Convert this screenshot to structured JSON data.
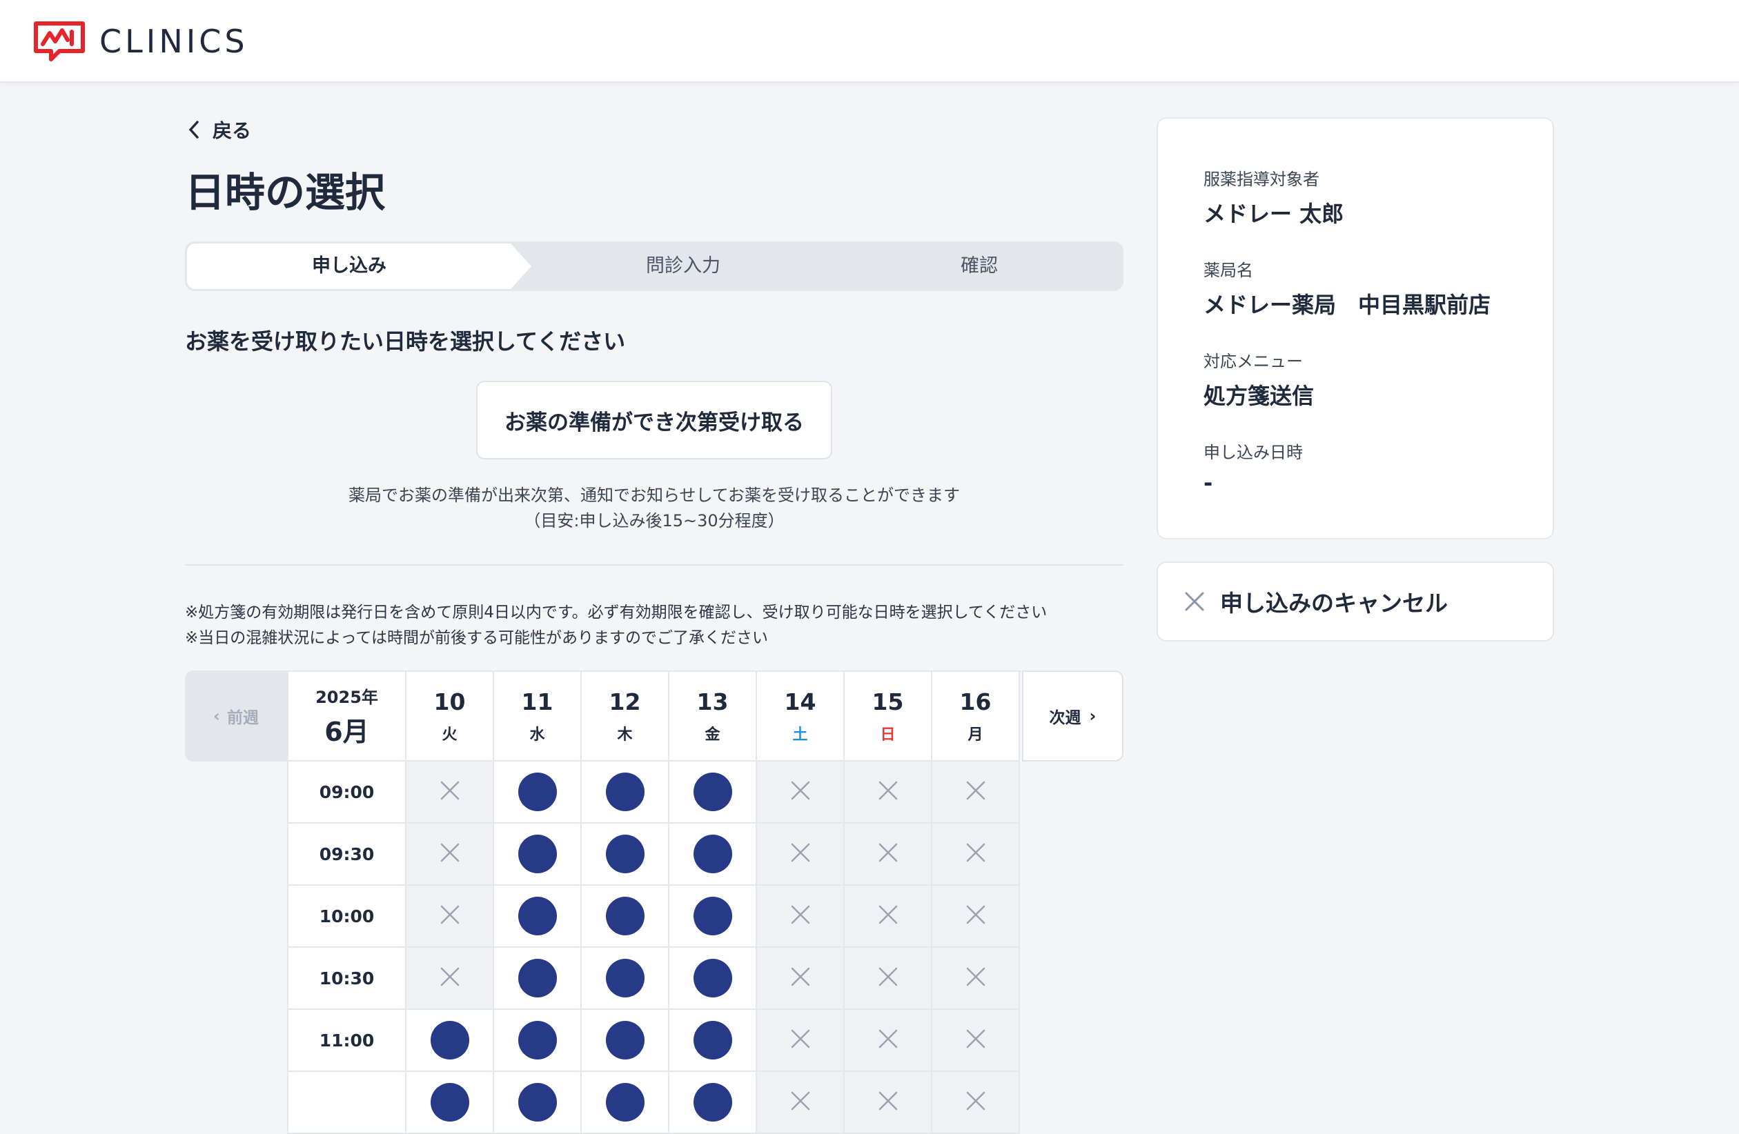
{
  "header": {
    "logo_text": "CLINICS",
    "brand_color": "#e5242b"
  },
  "back": {
    "label": "戻る"
  },
  "page_title": "日時の選択",
  "steps": [
    {
      "label": "申し込み",
      "active": true
    },
    {
      "label": "問診入力",
      "active": false
    },
    {
      "label": "確認",
      "active": false
    }
  ],
  "prompt": "お薬を受け取りたい日時を選択してください",
  "asap": {
    "button_label": "お薬の準備ができ次第受け取る",
    "desc_line1": "薬局でお薬の準備が出来次第、通知でお知らせしてお薬を受け取ることができます",
    "desc_line2": "（目安:申し込み後15~30分程度）"
  },
  "notes": {
    "line1": "※処方箋の有効期限は発行日を含めて原則4日以内です。必ず有効期限を確認し、受け取り可能な日時を選択してください",
    "line2": "※当日の混雑状況によっては時間が前後する可能性がありますのでご了承ください"
  },
  "calendar": {
    "prev_label": "前週",
    "next_label": "次週",
    "year": "2025年",
    "month": "6月",
    "days": [
      {
        "num": "10",
        "dow": "火",
        "type": "weekday"
      },
      {
        "num": "11",
        "dow": "水",
        "type": "weekday"
      },
      {
        "num": "12",
        "dow": "木",
        "type": "weekday"
      },
      {
        "num": "13",
        "dow": "金",
        "type": "weekday"
      },
      {
        "num": "14",
        "dow": "土",
        "type": "sat"
      },
      {
        "num": "15",
        "dow": "日",
        "type": "sun"
      },
      {
        "num": "16",
        "dow": "月",
        "type": "weekday"
      }
    ],
    "slots": [
      {
        "time": "09:00",
        "available": [
          false,
          true,
          true,
          true,
          false,
          false,
          false
        ]
      },
      {
        "time": "09:30",
        "available": [
          false,
          true,
          true,
          true,
          false,
          false,
          false
        ]
      },
      {
        "time": "10:00",
        "available": [
          false,
          true,
          true,
          true,
          false,
          false,
          false
        ]
      },
      {
        "time": "10:30",
        "available": [
          false,
          true,
          true,
          true,
          false,
          false,
          false
        ]
      },
      {
        "time": "11:00",
        "available": [
          true,
          true,
          true,
          true,
          false,
          false,
          false
        ]
      },
      {
        "time": "",
        "available": [
          true,
          true,
          true,
          true,
          false,
          false,
          false
        ]
      }
    ]
  },
  "summary": {
    "patient_label": "服薬指導対象者",
    "patient_value": "メドレー 太郎",
    "pharmacy_label": "薬局名",
    "pharmacy_value": "メドレー薬局　中目黒駅前店",
    "menu_label": "対応メニュー",
    "menu_value": "処方箋送信",
    "datetime_label": "申し込み日時",
    "datetime_value": "-"
  },
  "cancel": {
    "label": "申し込みのキャンセル"
  }
}
